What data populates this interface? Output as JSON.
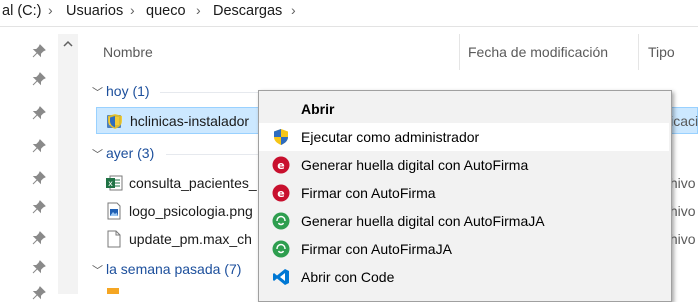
{
  "breadcrumb": {
    "items": [
      "al (C:)",
      "Usuarios",
      "queco",
      "Descargas"
    ],
    "separator": "›"
  },
  "columns": {
    "name": "Nombre",
    "modified": "Fecha de modificación",
    "type": "Tipo"
  },
  "groups": [
    {
      "label": "hoy (1)"
    },
    {
      "label": "ayer (3)"
    },
    {
      "label": "la semana pasada (7)"
    }
  ],
  "files": [
    {
      "name": "hclinicas-instalador",
      "type": "licacio",
      "icon": "installer-shield-icon",
      "selected": true
    },
    {
      "name": "consulta_pacientes_",
      "type": "thivo",
      "icon": "excel-icon"
    },
    {
      "name": "logo_psicologia.png",
      "type": "thivo",
      "icon": "image-file-icon"
    },
    {
      "name": "update_pm.max_ch",
      "type": "thivo",
      "icon": "generic-file-icon"
    }
  ],
  "context_menu": {
    "items": [
      {
        "label": "Abrir",
        "bold": true,
        "icon": ""
      },
      {
        "label": "Ejecutar como administrador",
        "icon": "uac-shield-icon"
      },
      {
        "label": "Generar huella digital con AutoFirma",
        "icon": "autofirma-icon"
      },
      {
        "label": "Firmar con AutoFirma",
        "icon": "autofirma-icon"
      },
      {
        "label": "Generar huella digital con AutoFirmaJA",
        "icon": "autofirmaja-icon"
      },
      {
        "label": "Firmar con AutoFirmaJA",
        "icon": "autofirmaja-icon"
      },
      {
        "label": "Abrir con Code",
        "icon": "vscode-icon"
      }
    ]
  },
  "colors": {
    "selection": "#cce8ff",
    "group_text": "#1c4f9c",
    "autofirma_red": "#c8102e",
    "autofirmaja_green": "#2e9e4f",
    "vscode_blue": "#0078d4"
  }
}
